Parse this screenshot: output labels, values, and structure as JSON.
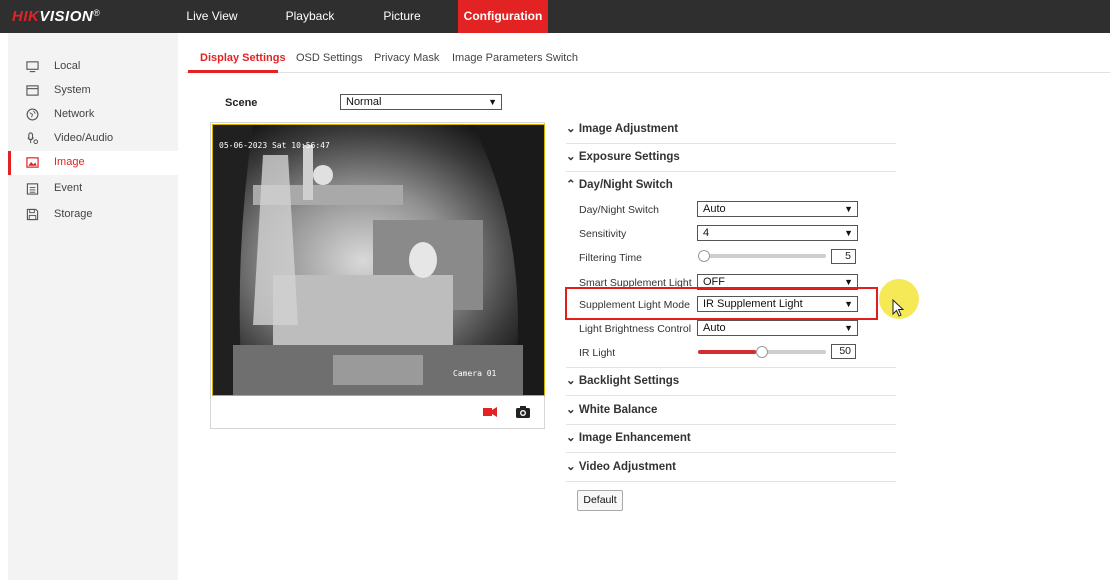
{
  "header": {
    "brand": "HIKVISION",
    "nav": [
      "Live View",
      "Playback",
      "Picture",
      "Configuration"
    ],
    "active_nav": "Configuration"
  },
  "sidebar": {
    "items": [
      {
        "label": "Local",
        "icon": "monitor-icon"
      },
      {
        "label": "System",
        "icon": "system-icon"
      },
      {
        "label": "Network",
        "icon": "globe-icon"
      },
      {
        "label": "Video/Audio",
        "icon": "video-audio-icon"
      },
      {
        "label": "Image",
        "icon": "image-icon"
      },
      {
        "label": "Event",
        "icon": "calendar-icon"
      },
      {
        "label": "Storage",
        "icon": "storage-icon"
      }
    ],
    "active_item": "Image"
  },
  "tabs": [
    "Display Settings",
    "OSD Settings",
    "Privacy Mask",
    "Image Parameters Switch"
  ],
  "scene": {
    "label": "Scene",
    "value": "Normal"
  },
  "preview": {
    "timestamp": "05-06-2023 Sat 10:56:47",
    "camera_name": "Camera 01",
    "record_icon": "record-icon",
    "snapshot_icon": "camera-icon"
  },
  "sections": {
    "image_adjustment": "Image Adjustment",
    "exposure_settings": "Exposure Settings",
    "day_night_switch": "Day/Night Switch",
    "backlight_settings": "Backlight Settings",
    "white_balance": "White Balance",
    "image_enhancement": "Image Enhancement",
    "video_adjustment": "Video Adjustment"
  },
  "daynight": {
    "switch_label": "Day/Night Switch",
    "switch_value": "Auto",
    "sensitivity_label": "Sensitivity",
    "sensitivity_value": "4",
    "filtering_label": "Filtering Time",
    "filtering_value": "5",
    "filtering_fraction": 0.0,
    "smart_light_label": "Smart Supplement Light",
    "smart_light_value": "OFF",
    "supplement_mode_label": "Supplement Light Mode",
    "supplement_mode_value": "IR Supplement Light",
    "brightness_label": "Light Brightness Control",
    "brightness_value": "Auto",
    "ir_label": "IR Light",
    "ir_value": "50",
    "ir_fraction": 0.5
  },
  "buttons": {
    "default": "Default"
  },
  "colors": {
    "accent": "#e32323",
    "topbar": "#2f2f2f"
  }
}
